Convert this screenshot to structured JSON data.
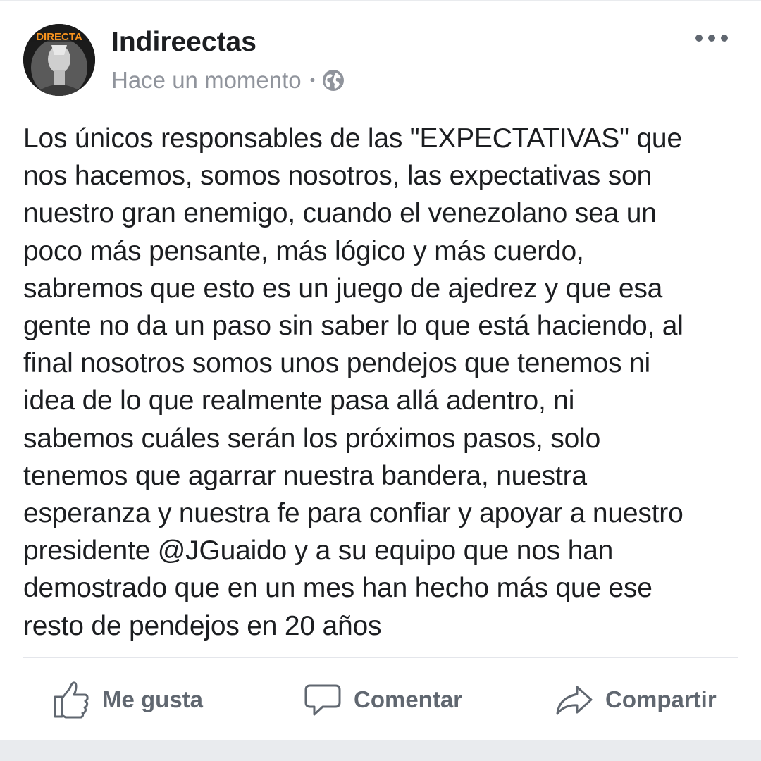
{
  "post": {
    "author": "Indireectas",
    "avatar": {
      "badge_text": "DIRECTA",
      "accent_color": "#f7931e"
    },
    "timestamp": "Hace un momento",
    "separator": "•",
    "privacy_icon": "globe-icon",
    "more_icon": "more-options-icon",
    "text_lines": [
      "Los únicos responsables de las \"EXPECTATIVAS\" que",
      "nos hacemos, somos nosotros, las expectativas son",
      "nuestro gran enemigo, cuando el venezolano sea un",
      "poco más pensante, más lógico y más cuerdo,",
      "sabremos que esto es un juego de ajedrez y que esa",
      "gente no da un paso sin saber lo que está haciendo, al",
      "final nosotros somos unos pendejos que tenemos ni",
      "idea de lo que realmente pasa allá adentro, ni",
      "sabemos cuáles serán los próximos pasos, solo",
      "tenemos que agarrar nuestra bandera, nuestra",
      "esperanza y nuestra fe para confiar y apoyar a nuestro",
      "presidente @JGuaido y a su equipo que nos han",
      "demostrado que en un mes han hecho más que ese",
      "resto de pendejos en 20 años"
    ]
  },
  "actions": {
    "like": {
      "label": "Me gusta",
      "icon": "thumbs-up-icon"
    },
    "comment": {
      "label": "Comentar",
      "icon": "comment-icon"
    },
    "share": {
      "label": "Compartir",
      "icon": "share-icon"
    }
  },
  "colors": {
    "text": "#1c1e21",
    "meta": "#90949c",
    "action": "#606770",
    "divider": "#e4e6eb"
  }
}
